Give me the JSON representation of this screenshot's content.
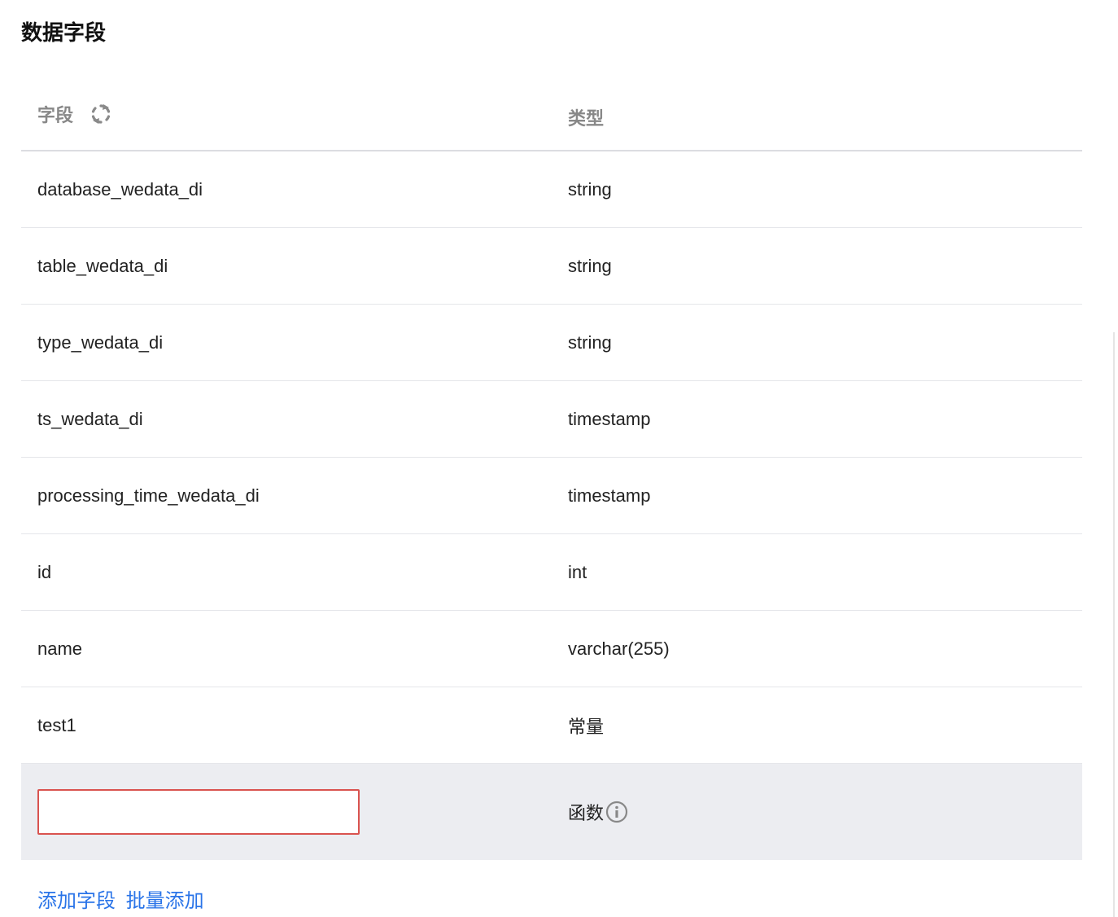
{
  "title": "数据字段",
  "table": {
    "columns": {
      "field": "字段",
      "type": "类型"
    },
    "rows": [
      {
        "name": "database_wedata_di",
        "type": "string"
      },
      {
        "name": "table_wedata_di",
        "type": "string"
      },
      {
        "name": "type_wedata_di",
        "type": "string"
      },
      {
        "name": "ts_wedata_di",
        "type": "timestamp"
      },
      {
        "name": "processing_time_wedata_di",
        "type": "timestamp"
      },
      {
        "name": "id",
        "type": "int"
      },
      {
        "name": "name",
        "type": "varchar(255)"
      },
      {
        "name": "test1",
        "type": "常量"
      }
    ],
    "edit_row": {
      "input_value": "",
      "type": "函数"
    }
  },
  "actions": {
    "add_field": "添加字段",
    "batch_add": "批量添加"
  },
  "icons": {
    "refresh": "refresh-icon",
    "info": "info-icon"
  },
  "colors": {
    "link": "#2a74e8",
    "error_border": "#d9534f",
    "edit_row_bg": "#ecedf1"
  }
}
